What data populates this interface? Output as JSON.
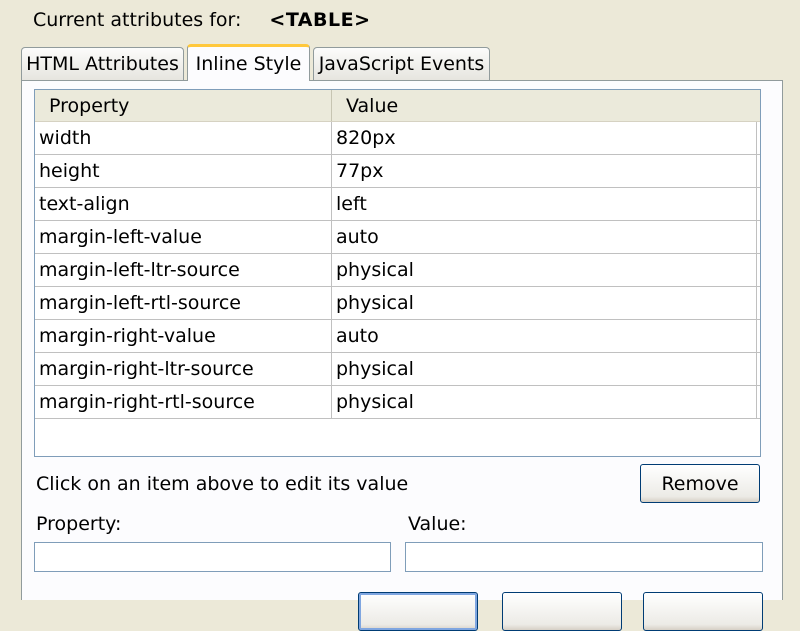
{
  "header": {
    "label": "Current attributes for:",
    "element": "<TABLE>"
  },
  "tabs": [
    {
      "label": "HTML Attributes",
      "active": false
    },
    {
      "label": "Inline Style",
      "active": true
    },
    {
      "label": "JavaScript Events",
      "active": false
    }
  ],
  "grid": {
    "columns": {
      "property": "Property",
      "value": "Value"
    },
    "rows": [
      {
        "property": "width",
        "value": "820px"
      },
      {
        "property": "height",
        "value": "77px"
      },
      {
        "property": "text-align",
        "value": "left"
      },
      {
        "property": "margin-left-value",
        "value": "auto"
      },
      {
        "property": "margin-left-ltr-source",
        "value": "physical"
      },
      {
        "property": "margin-left-rtl-source",
        "value": "physical"
      },
      {
        "property": "margin-right-value",
        "value": "auto"
      },
      {
        "property": "margin-right-ltr-source",
        "value": "physical"
      },
      {
        "property": "margin-right-rtl-source",
        "value": "physical"
      }
    ]
  },
  "hint": "Click on an item above to edit its value",
  "remove_label": "Remove",
  "property_label": "Property:",
  "value_label": "Value:",
  "property_value": "",
  "value_value": "",
  "colors": {
    "dialog_bg": "#ece9d8",
    "active_tab_accent": "#ffc83c",
    "border": "#7f9db9"
  }
}
